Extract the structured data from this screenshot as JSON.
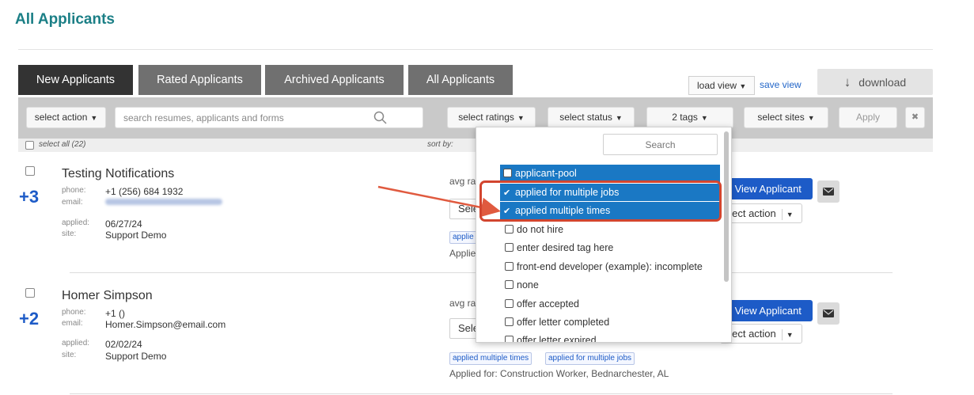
{
  "page": {
    "title": "All Applicants"
  },
  "tabs": [
    "New Applicants",
    "Rated Applicants",
    "Archived Applicants",
    "All Applicants"
  ],
  "views": {
    "load_view": "load view",
    "save_view": "save view",
    "download": "download"
  },
  "filters": {
    "select_action": "select action",
    "search_placeholder": "search resumes, applicants and forms",
    "select_ratings": "select ratings",
    "select_status": "select status",
    "tags": "2 tags",
    "select_sites": "select sites",
    "apply": "Apply",
    "clear": "✖"
  },
  "list_header": {
    "select_all": "select all (22)",
    "sort_by": "sort by:"
  },
  "applicants": [
    {
      "rating_badge": "+3",
      "name": "Testing Notifications",
      "phone_label": "phone:",
      "phone": "+1 (256) 684 1932",
      "email_label": "email:",
      "email": "",
      "applied_label": "applied:",
      "applied": "06/27/24",
      "site_label": "site:",
      "site": "Support Demo",
      "avg_rating": "avg ra",
      "status_select": "Sele",
      "tags": [
        "applie"
      ],
      "applied_for": "Applie",
      "view_button": "View Applicant",
      "action_select": "elect action"
    },
    {
      "rating_badge": "+2",
      "name": "Homer Simpson",
      "phone_label": "phone:",
      "phone": "+1 ()",
      "email_label": "email:",
      "email": "Homer.Simpson@email.com",
      "applied_label": "applied:",
      "applied": "02/02/24",
      "site_label": "site:",
      "site": "Support Demo",
      "avg_rating": "avg ra",
      "status_select": "Sele",
      "tags": [
        "applied multiple times",
        "applied for multiple jobs"
      ],
      "applied_for": "Applied for: Construction Worker, Bednarchester, AL",
      "view_button": "View Applicant",
      "action_select": "elect action"
    }
  ],
  "tag_dropdown": {
    "search_placeholder": "Search",
    "items": [
      {
        "label": "applicant-pool",
        "checked": false
      },
      {
        "label": "applied for multiple jobs",
        "checked": true
      },
      {
        "label": "applied multiple times",
        "checked": true
      },
      {
        "label": "do not hire",
        "checked": false
      },
      {
        "label": "enter desired tag here",
        "checked": false
      },
      {
        "label": "front-end developer (example): incomplete",
        "checked": false
      },
      {
        "label": "none",
        "checked": false
      },
      {
        "label": "offer accepted",
        "checked": false
      },
      {
        "label": "offer letter completed",
        "checked": false
      },
      {
        "label": "offer letter expired",
        "checked": false
      }
    ]
  },
  "colors": {
    "title_teal": "#1b7f86",
    "accent_blue": "#1d5bc7",
    "highlight_blue": "#1a78c4",
    "annotation_red": "#d2452f"
  }
}
